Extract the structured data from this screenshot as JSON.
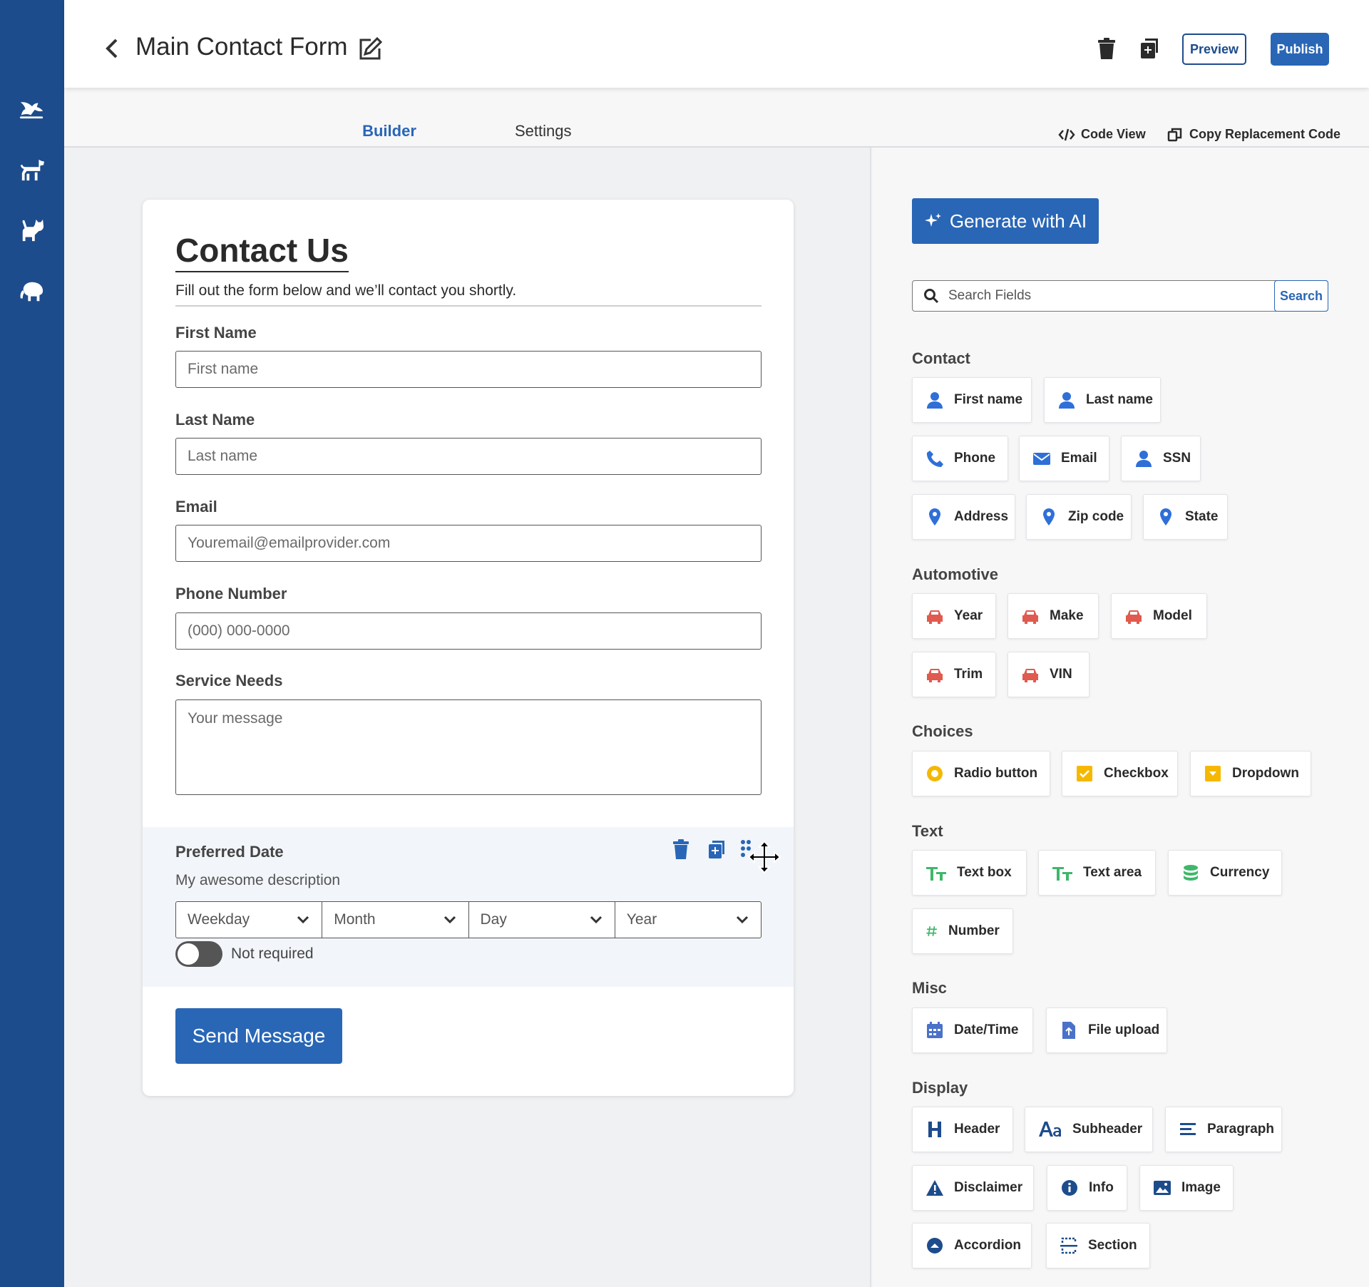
{
  "header": {
    "title": "Main Contact Form",
    "preview_label": "Preview",
    "publish_label": "Publish"
  },
  "tabs": {
    "builder": "Builder",
    "settings": "Settings",
    "code_view": "Code View",
    "copy_code": "Copy Replacement Code"
  },
  "form": {
    "title": "Contact Us",
    "subtitle": "Fill out the form below and we’ll contact you shortly.",
    "first_name_label": "First Name",
    "first_name_placeholder": "First name",
    "last_name_label": "Last Name",
    "last_name_placeholder": "Last name",
    "email_label": "Email",
    "email_placeholder": "Youremail@emailprovider.com",
    "phone_label": "Phone Number",
    "phone_placeholder": "(000) 000-0000",
    "service_label": "Service Needs",
    "service_placeholder": "Your message",
    "date_label": "Preferred Date",
    "date_description": "My awesome description",
    "date_selects": [
      "Weekday",
      "Month",
      "Day",
      "Year"
    ],
    "required_text": "Not required",
    "submit_label": "Send Message"
  },
  "panel": {
    "generate_label": "Generate with AI",
    "search_placeholder": "Search Fields",
    "search_button": "Search",
    "sections": {
      "contact": "Contact",
      "automotive": "Automotive",
      "choices": "Choices",
      "text": "Text",
      "misc": "Misc",
      "display": "Display"
    },
    "chips": {
      "first_name": "First name",
      "last_name": "Last name",
      "phone": "Phone",
      "email": "Email",
      "ssn": "SSN",
      "address": "Address",
      "zip": "Zip code",
      "state": "State",
      "year": "Year",
      "make": "Make",
      "model": "Model",
      "trim": "Trim",
      "vin": "VIN",
      "radio": "Radio button",
      "checkbox": "Checkbox",
      "dropdown": "Dropdown",
      "text_box": "Text box",
      "text_area": "Text area",
      "currency": "Currency",
      "number": "Number",
      "datetime": "Date/Time",
      "file_upload": "File upload",
      "header": "Header",
      "subheader": "Subheader",
      "paragraph": "Paragraph",
      "disclaimer": "Disclaimer",
      "info": "Info",
      "image": "Image",
      "accordion": "Accordion",
      "section": "Section"
    }
  },
  "colors": {
    "rail": "#1d4c8c",
    "primary": "#2966b6",
    "contact_icon": "#2f6fd8",
    "auto_icon": "#e05a4f",
    "choice_icon": "#f5b800",
    "text_icon": "#3fb76a",
    "misc_icon": "#4a72c8",
    "display_icon": "#1d4c8c"
  }
}
